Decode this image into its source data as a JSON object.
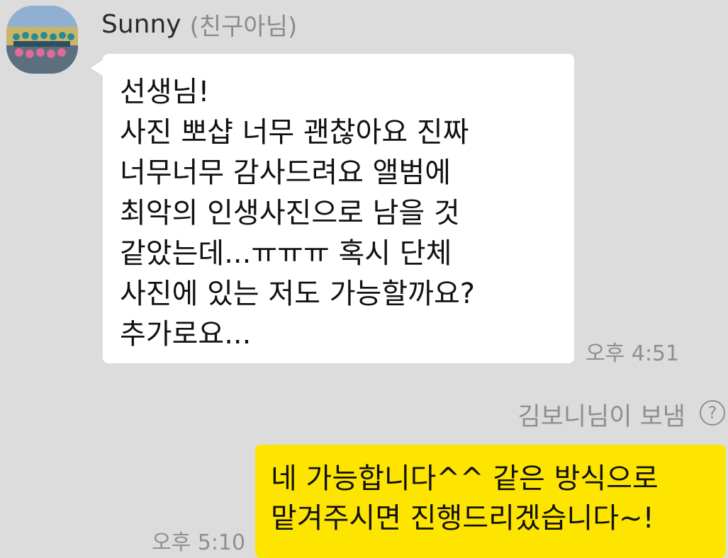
{
  "chat": {
    "incoming": {
      "sender_name": "Sunny",
      "sender_status": "(친구아님)",
      "avatar_icon": "group-photo-avatar",
      "lines": [
        "선생님!",
        "사진 뽀샵 너무 괜찮아요 진짜",
        "너무너무 감사드려요 앨범에",
        "최악의 인생사진으로 남을 것",
        "같았는데...ㅠㅠㅠ 혹시 단체",
        "사진에 있는 저도 가능할까요?",
        "추가로요..."
      ],
      "time": "오후 4:51",
      "bubble_color": "#ffffff"
    },
    "outgoing": {
      "sent_by": "김보니님이 보냄",
      "help_icon": "question-circle-icon",
      "help_glyph": "?",
      "lines": [
        "네 가능합니다^^ 같은 방식으로",
        "맡겨주시면 진행드리겠습니다~!"
      ],
      "time": "오후 5:10",
      "bubble_color": "#fee500"
    },
    "background_color": "#dcdcdc"
  }
}
